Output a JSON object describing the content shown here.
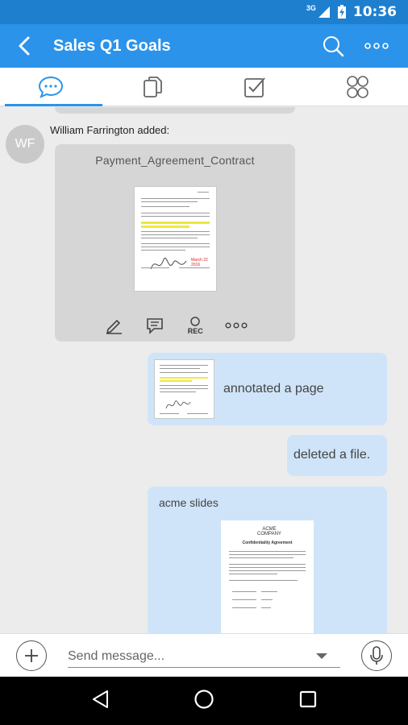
{
  "status_bar": {
    "network": "3G",
    "time": "10:36"
  },
  "app_bar": {
    "title": "Sales Q1 Goals"
  },
  "tabs": [
    {
      "name": "chat",
      "icon": "chat-bubble-icon",
      "active": true
    },
    {
      "name": "files",
      "icon": "files-icon",
      "active": false
    },
    {
      "name": "tasks",
      "icon": "checkbox-icon",
      "active": false
    },
    {
      "name": "members",
      "icon": "members-icon",
      "active": false
    }
  ],
  "messages": {
    "file_share": {
      "avatar_initials": "WF",
      "sender_line": "William Farrington added:",
      "file_name": "Payment_Agreement_Contract",
      "rec_label": "REC",
      "signature_date": "March 22 2016"
    },
    "annotation": {
      "text": "annotated a page"
    },
    "deletion": {
      "text": "deleted a file."
    },
    "slides": {
      "title": "acme slides",
      "doc_logo": "ACME COMPANY",
      "doc_heading": "Confidentiality Agreement"
    }
  },
  "composer": {
    "placeholder": "Send message..."
  },
  "colors": {
    "accent": "#2b93ea",
    "status_bar": "#1f7fcf",
    "bubble_blue": "#cfe4f8",
    "bubble_gray": "#d6d6d6"
  }
}
